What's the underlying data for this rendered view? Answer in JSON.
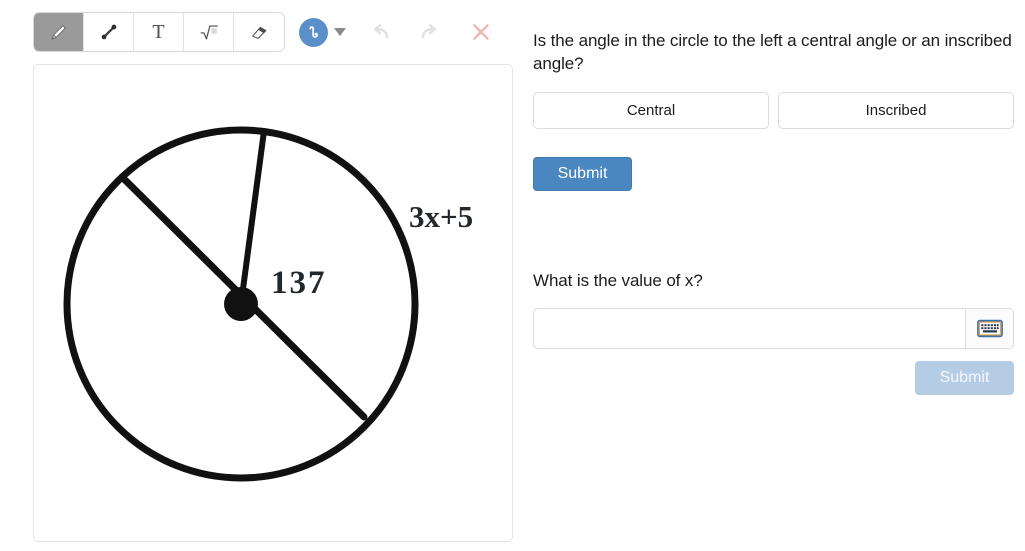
{
  "toolbar": {
    "tools": [
      {
        "name": "pencil-tool",
        "icon": "pencil-icon",
        "active": true
      },
      {
        "name": "line-tool",
        "icon": "line-segment-icon",
        "active": false
      },
      {
        "name": "text-tool",
        "icon": "text-t-icon",
        "active": false,
        "label": "T"
      },
      {
        "name": "math-tool",
        "icon": "square-root-icon",
        "active": false
      },
      {
        "name": "eraser-tool",
        "icon": "eraser-icon",
        "active": false
      }
    ],
    "stroke_picker": {
      "icon": "squiggle-stroke-icon",
      "color": "#5b8fc9",
      "caret_icon": "chevron-down-icon"
    },
    "undo": {
      "icon": "undo-arrow-icon",
      "enabled": false
    },
    "redo": {
      "icon": "redo-arrow-icon",
      "enabled": false
    },
    "clear": {
      "icon": "close-x-icon",
      "color": "#efb9b9"
    }
  },
  "figure": {
    "label_angle": "137",
    "label_expression": "3x+5",
    "description": "circle-with-central-angle"
  },
  "questions": {
    "q1": {
      "text": "Is the angle in the circle to the left a central angle or an inscribed angle?",
      "choices": [
        {
          "label": "Central",
          "name": "choice-central"
        },
        {
          "label": "Inscribed",
          "name": "choice-inscribed"
        }
      ],
      "submit_label": "Submit"
    },
    "q2": {
      "text": "What is the value of x?",
      "input_value": "",
      "input_placeholder": "",
      "keyboard_icon": "keyboard-icon",
      "submit_label": "Submit",
      "submit_disabled": true
    }
  },
  "colors": {
    "accent_blue": "#4a86c0",
    "disabled_blue": "#b4cde4",
    "clear_red": "#efb9b9"
  }
}
